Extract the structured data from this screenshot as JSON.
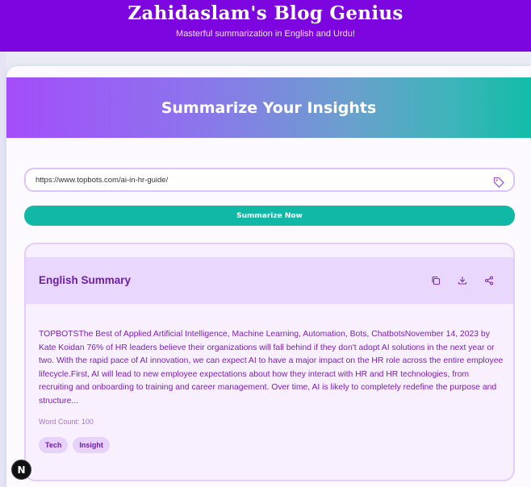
{
  "header": {
    "title": "Zahidaslam's Blog Genius",
    "subtitle": "Masterful summarization in English and Urdu!"
  },
  "hero": {
    "title": "Summarize Your Insights"
  },
  "url_input": {
    "value": "https://www.topbots.com/ai-in-hr-guide/",
    "icon": "tag-icon"
  },
  "summarize_button": {
    "label": "Summarize Now"
  },
  "summary": {
    "title": "English Summary",
    "actions": [
      {
        "icon": "copy-icon"
      },
      {
        "icon": "download-icon"
      },
      {
        "icon": "share-icon"
      }
    ],
    "text": "TOPBOTSThe Best of Applied Artificial Intelligence, Machine Learning, Automation, Bots, ChatbotsNovember 14, 2023 by Kate Koidan 76% of HR leaders believe their organizations will fall behind if they don't adopt AI solutions in the next year or two. With the rapid pace of AI innovation, we can expect AI to have a major impact on the HR role across the entire employee lifecycle.First, AI will lead to new employee expectations about how they interact with HR and HR technologies, from recruiting and onboarding to training and career management. Over time, AI is likely to completely redefine the purpose and structure...",
    "word_count": "Word Count: 100",
    "tags": [
      "Tech",
      "Insight"
    ]
  },
  "dev_badge": {
    "label": "N"
  },
  "colors": {
    "header_bg": "#7c05e0",
    "accent_teal": "#12b8a6",
    "summary_text": "#7b1fb3"
  }
}
